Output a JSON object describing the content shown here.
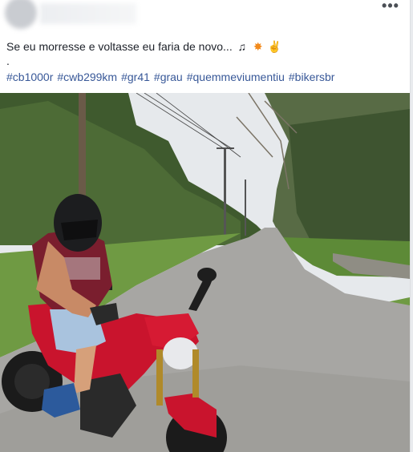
{
  "post": {
    "more_label": "•••",
    "text": "Se eu morresse e voltasse eu faria de novo...",
    "emojis": [
      "music-note",
      "collision",
      "rock-hand"
    ],
    "dot": ".",
    "hashtags": [
      "#cb1000r",
      "#cwb299km",
      "#gr41",
      "#grau",
      "#quemmeviumentiu",
      "#bikersbr"
    ]
  },
  "photo": {
    "subject": "rider-on-red-motorcycle",
    "colors": {
      "sky": "#e6e9ec",
      "road": "#a7a6a3",
      "grass": "#6f9a43",
      "bike": "#c9142d",
      "shirt": "#7a1e2e"
    }
  }
}
